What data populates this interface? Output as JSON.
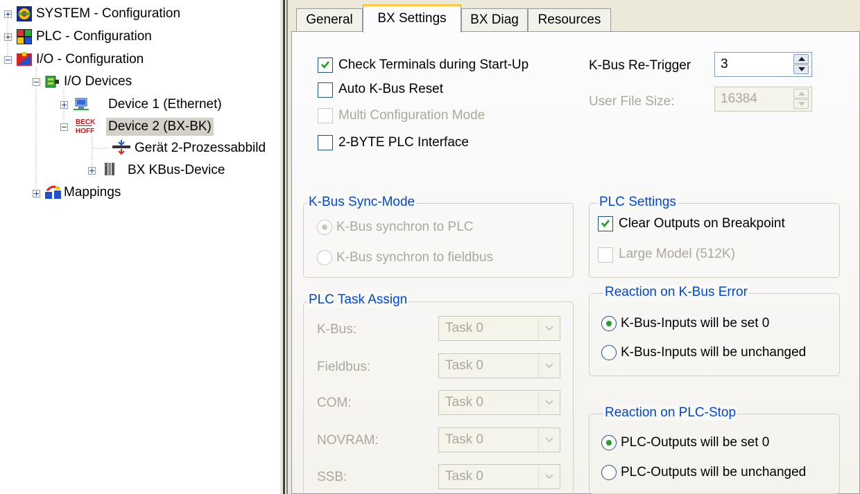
{
  "tree": {
    "items": [
      {
        "label": "SYSTEM - Configuration",
        "icon": "system-config-icon"
      },
      {
        "label": "PLC - Configuration",
        "icon": "plc-config-icon"
      },
      {
        "label": "I/O - Configuration",
        "icon": "io-config-icon"
      },
      {
        "label": "I/O Devices",
        "icon": "io-devices-icon"
      },
      {
        "label": "Device 1 (Ethernet)",
        "icon": "ethernet-device-icon"
      },
      {
        "label": "Device 2 (BX-BK)",
        "icon": "beckhoff-device-icon",
        "logo_text": "BECK HOFF"
      },
      {
        "label": "Gerät 2-Prozessabbild",
        "icon": "process-image-icon"
      },
      {
        "label": "BX KBus-Device",
        "icon": "kbus-device-icon"
      },
      {
        "label": "Mappings",
        "icon": "mappings-icon"
      }
    ]
  },
  "tabs": [
    {
      "label": "General"
    },
    {
      "label": "BX Settings"
    },
    {
      "label": "BX Diag"
    },
    {
      "label": "Resources"
    }
  ],
  "bx_settings": {
    "check_terminals": {
      "label": "Check Terminals during Start-Up",
      "checked": true
    },
    "auto_kbus_reset": {
      "label": "Auto K-Bus Reset",
      "checked": false
    },
    "multi_config": {
      "label": "Multi Configuration Mode",
      "checked": false,
      "enabled": false
    },
    "two_byte_plc": {
      "label": "2-BYTE PLC Interface",
      "checked": false
    },
    "kbus_retrigger": {
      "label": "K-Bus Re-Trigger",
      "value": "3"
    },
    "user_file_size": {
      "label": "User File Size:",
      "value": "16384"
    },
    "kbus_sync": {
      "title": "K-Bus Sync-Mode",
      "opt1": "K-Bus synchron to PLC",
      "opt2": "K-Bus synchron to fieldbus"
    },
    "plc_settings": {
      "title": "PLC Settings",
      "clear_outputs": "Clear Outputs on Breakpoint",
      "large_model": "Large Model (512K)"
    },
    "plc_task_assign": {
      "title": "PLC Task Assign",
      "rows": [
        {
          "label": "K-Bus:",
          "value": "Task 0"
        },
        {
          "label": "Fieldbus:",
          "value": "Task 0"
        },
        {
          "label": "COM:",
          "value": "Task 0"
        },
        {
          "label": "NOVRAM:",
          "value": "Task 0"
        },
        {
          "label": "SSB:",
          "value": "Task 0"
        }
      ]
    },
    "reaction_kbus_error": {
      "title": "Reaction on K-Bus Error",
      "opt1": "K-Bus-Inputs will be set 0",
      "opt2": "K-Bus-Inputs will be unchanged"
    },
    "reaction_plc_stop": {
      "title": "Reaction on PLC-Stop",
      "opt1": "PLC-Outputs will be set 0",
      "opt2": "PLC-Outputs will be unchanged"
    }
  },
  "colors": {
    "group_title": "#0046d5",
    "check_mark": "#21a121",
    "disabled_text": "#aca899"
  }
}
